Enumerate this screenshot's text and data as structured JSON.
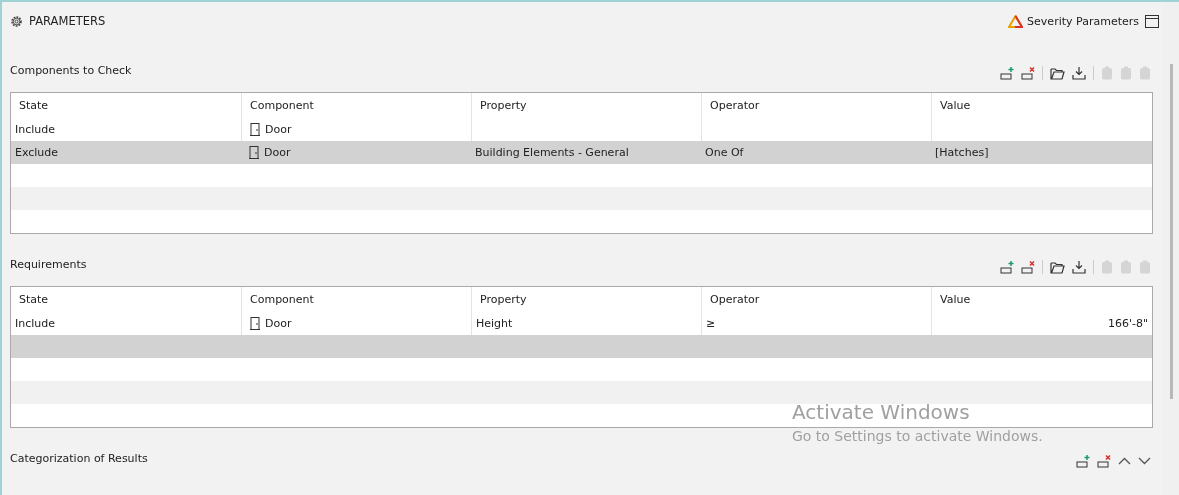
{
  "panel": {
    "title": "PARAMETERS",
    "severity_link": "Severity Parameters"
  },
  "sections": [
    {
      "title": "Components to Check",
      "tools": [
        {
          "kind": "add",
          "disabled": false
        },
        {
          "kind": "remove",
          "disabled": false
        },
        {
          "kind": "open",
          "disabled": false
        },
        {
          "kind": "save",
          "disabled": false
        },
        {
          "kind": "clip",
          "disabled": true
        },
        {
          "kind": "clip",
          "disabled": true
        },
        {
          "kind": "clip",
          "disabled": true
        }
      ],
      "columns": [
        "State",
        "Component",
        "Property",
        "Operator",
        "Value"
      ],
      "rows": [
        {
          "selected": false,
          "state": "Include",
          "component": "Door",
          "property": "",
          "operator": "",
          "value": ""
        },
        {
          "selected": true,
          "state": "Exclude",
          "component": "Door",
          "property": "Building Elements - General",
          "operator": "One Of",
          "value": "[Hatches]"
        },
        {
          "selected": false
        },
        {
          "selected": false
        },
        {
          "selected": false
        }
      ]
    },
    {
      "title": "Requirements",
      "tools": [
        {
          "kind": "add",
          "disabled": false
        },
        {
          "kind": "remove",
          "disabled": false
        },
        {
          "kind": "open",
          "disabled": false
        },
        {
          "kind": "save",
          "disabled": false
        },
        {
          "kind": "clip",
          "disabled": true
        },
        {
          "kind": "clip",
          "disabled": true
        },
        {
          "kind": "clip",
          "disabled": true
        }
      ],
      "columns": [
        "State",
        "Component",
        "Property",
        "Operator",
        "Value"
      ],
      "rows": [
        {
          "selected": false,
          "state": "Include",
          "component": "Door",
          "property": "Height",
          "operator": "≥",
          "value": "166'-8\"",
          "kind": "measure"
        },
        {
          "selected": true
        },
        {
          "selected": false
        },
        {
          "selected": false
        },
        {
          "selected": false
        }
      ]
    },
    {
      "title": "Categorization of Results",
      "tools": [
        {
          "kind": "add",
          "disabled": false
        },
        {
          "kind": "remove",
          "disabled": false
        },
        {
          "kind": "up",
          "disabled": false
        },
        {
          "kind": "down",
          "disabled": false
        }
      ]
    }
  ],
  "os_notice": {
    "title": "Activate Windows",
    "text": "Go to Settings to activate Windows."
  }
}
